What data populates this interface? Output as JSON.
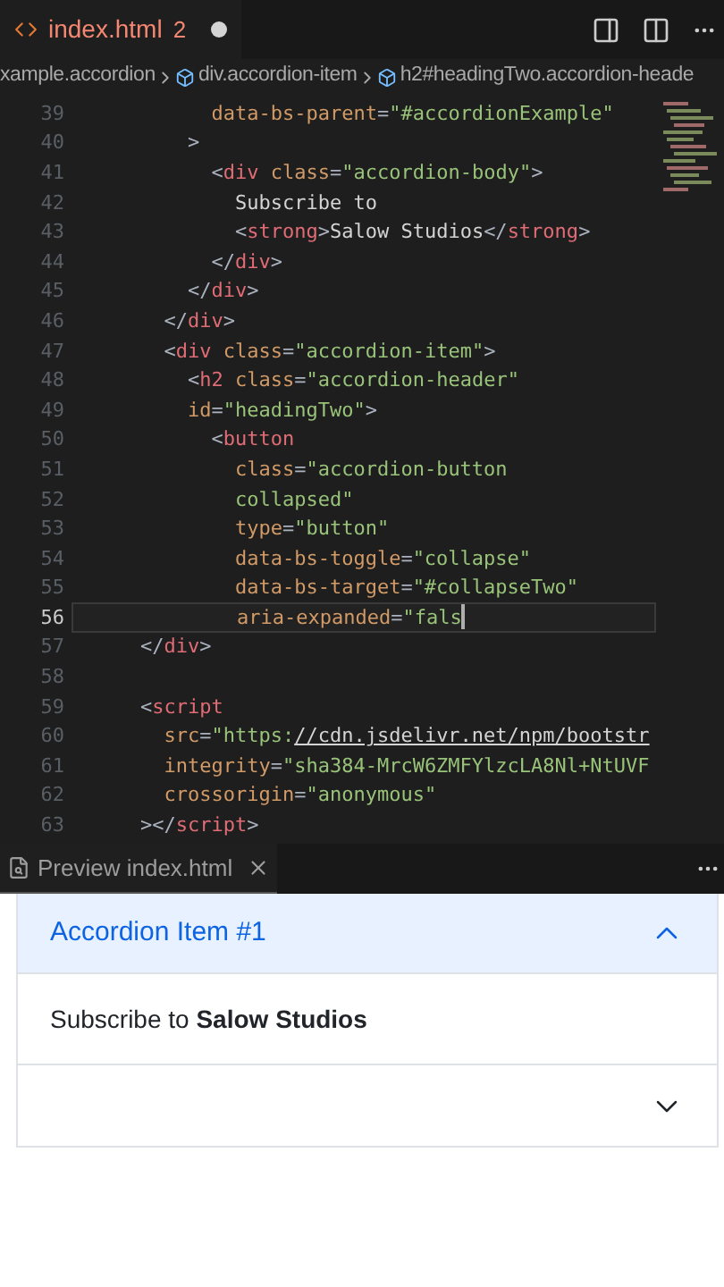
{
  "editor_tab": {
    "label": "index.html",
    "badge": "2",
    "modified": true,
    "selected": true
  },
  "breadcrumbs": [
    {
      "kind": "text",
      "label": "xample.accordion"
    },
    {
      "kind": "element",
      "label": "div.accordion-item"
    },
    {
      "kind": "element",
      "label": "h2#headingTwo.accordion-heade"
    }
  ],
  "editor": {
    "lines": [
      {
        "number": "39",
        "current": false,
        "tokens": [
          {
            "kind": "attr",
            "text": "          data-bs-parent"
          },
          {
            "kind": "punct",
            "text": "="
          },
          {
            "kind": "str",
            "text": "\"#accordionExample\""
          }
        ]
      },
      {
        "number": "40",
        "current": false,
        "tokens": [
          {
            "kind": "punct",
            "text": "        >"
          }
        ]
      },
      {
        "number": "41",
        "current": false,
        "tokens": [
          {
            "kind": "punct",
            "text": "          <"
          },
          {
            "kind": "tag",
            "text": "div"
          },
          {
            "kind": "attr",
            "text": " class"
          },
          {
            "kind": "punct",
            "text": "="
          },
          {
            "kind": "str",
            "text": "\"accordion-body\""
          },
          {
            "kind": "punct",
            "text": ">"
          }
        ]
      },
      {
        "number": "42",
        "current": false,
        "tokens": [
          {
            "kind": "text",
            "text": "            Subscribe to"
          }
        ]
      },
      {
        "number": "43",
        "current": false,
        "tokens": [
          {
            "kind": "punct",
            "text": "            <"
          },
          {
            "kind": "tag",
            "text": "strong"
          },
          {
            "kind": "punct",
            "text": ">"
          },
          {
            "kind": "text",
            "text": "Salow Studios"
          },
          {
            "kind": "punct",
            "text": "</"
          },
          {
            "kind": "tag",
            "text": "strong"
          },
          {
            "kind": "punct",
            "text": ">"
          }
        ]
      },
      {
        "number": "44",
        "current": false,
        "tokens": [
          {
            "kind": "punct",
            "text": "          </"
          },
          {
            "kind": "tag",
            "text": "div"
          },
          {
            "kind": "punct",
            "text": ">"
          }
        ]
      },
      {
        "number": "45",
        "current": false,
        "tokens": [
          {
            "kind": "punct",
            "text": "        </"
          },
          {
            "kind": "tag",
            "text": "div"
          },
          {
            "kind": "punct",
            "text": ">"
          }
        ]
      },
      {
        "number": "46",
        "current": false,
        "tokens": [
          {
            "kind": "punct",
            "text": "      </"
          },
          {
            "kind": "tag",
            "text": "div"
          },
          {
            "kind": "punct",
            "text": ">"
          }
        ]
      },
      {
        "number": "47",
        "current": false,
        "tokens": [
          {
            "kind": "punct",
            "text": "      <"
          },
          {
            "kind": "tag",
            "text": "div"
          },
          {
            "kind": "attr",
            "text": " class"
          },
          {
            "kind": "punct",
            "text": "="
          },
          {
            "kind": "str",
            "text": "\"accordion-item\""
          },
          {
            "kind": "punct",
            "text": ">"
          }
        ]
      },
      {
        "number": "48",
        "current": false,
        "tokens": [
          {
            "kind": "punct",
            "text": "        <"
          },
          {
            "kind": "tag",
            "text": "h2"
          },
          {
            "kind": "attr",
            "text": " class"
          },
          {
            "kind": "punct",
            "text": "="
          },
          {
            "kind": "str",
            "text": "\"accordion-header\""
          }
        ]
      },
      {
        "number": "49",
        "current": false,
        "tokens": [
          {
            "kind": "attr",
            "text": "        id"
          },
          {
            "kind": "punct",
            "text": "="
          },
          {
            "kind": "str",
            "text": "\"headingTwo\""
          },
          {
            "kind": "punct",
            "text": ">"
          }
        ]
      },
      {
        "number": "50",
        "current": false,
        "tokens": [
          {
            "kind": "punct",
            "text": "          <"
          },
          {
            "kind": "tag",
            "text": "button"
          }
        ]
      },
      {
        "number": "51",
        "current": false,
        "tokens": [
          {
            "kind": "attr",
            "text": "            class"
          },
          {
            "kind": "punct",
            "text": "="
          },
          {
            "kind": "str",
            "text": "\"accordion-button"
          }
        ]
      },
      {
        "number": "52",
        "current": false,
        "tokens": [
          {
            "kind": "str",
            "text": "            collapsed\""
          }
        ]
      },
      {
        "number": "53",
        "current": false,
        "tokens": [
          {
            "kind": "attr",
            "text": "            type"
          },
          {
            "kind": "punct",
            "text": "="
          },
          {
            "kind": "str",
            "text": "\"button\""
          }
        ]
      },
      {
        "number": "54",
        "current": false,
        "tokens": [
          {
            "kind": "attr",
            "text": "            data-bs-toggle"
          },
          {
            "kind": "punct",
            "text": "="
          },
          {
            "kind": "str",
            "text": "\"collapse\""
          }
        ]
      },
      {
        "number": "55",
        "current": false,
        "tokens": [
          {
            "kind": "attr",
            "text": "            data-bs-target"
          },
          {
            "kind": "punct",
            "text": "="
          },
          {
            "kind": "str",
            "text": "\"#collapseTwo\""
          }
        ]
      },
      {
        "number": "56",
        "current": true,
        "tokens": [
          {
            "kind": "attr",
            "text": "            aria-expanded"
          },
          {
            "kind": "punct",
            "text": "="
          },
          {
            "kind": "str",
            "text": "\"fals"
          }
        ]
      },
      {
        "number": "57",
        "current": false,
        "tokens": [
          {
            "kind": "punct",
            "text": "    </"
          },
          {
            "kind": "tag",
            "text": "div"
          },
          {
            "kind": "punct",
            "text": ">"
          }
        ]
      },
      {
        "number": "58",
        "current": false
      },
      {
        "number": "59",
        "current": false,
        "tokens": [
          {
            "kind": "punct",
            "text": "    <"
          },
          {
            "kind": "tag",
            "text": "script"
          }
        ]
      },
      {
        "number": "60",
        "current": false,
        "tokens": [
          {
            "kind": "attr",
            "text": "      src"
          },
          {
            "kind": "punct",
            "text": "="
          },
          {
            "kind": "str",
            "text": "\"https:"
          },
          {
            "kind": "link",
            "text": "//cdn.jsdelivr.net/npm/bootstr"
          }
        ]
      },
      {
        "number": "61",
        "current": false,
        "tokens": [
          {
            "kind": "attr",
            "text": "      integrity"
          },
          {
            "kind": "punct",
            "text": "="
          },
          {
            "kind": "str",
            "text": "\"sha384-MrcW6ZMFYlzcLA8Nl+NtUVF"
          }
        ]
      },
      {
        "number": "62",
        "current": false,
        "tokens": [
          {
            "kind": "attr",
            "text": "      crossorigin"
          },
          {
            "kind": "punct",
            "text": "="
          },
          {
            "kind": "str",
            "text": "\"anonymous\""
          }
        ]
      },
      {
        "number": "63",
        "current": false,
        "tokens": [
          {
            "kind": "punct",
            "text": "    ></"
          },
          {
            "kind": "tag",
            "text": "script"
          },
          {
            "kind": "punct",
            "text": ">"
          }
        ]
      }
    ]
  },
  "preview_tab": {
    "label": "Preview index.html"
  },
  "accordion": {
    "items": [
      {
        "title": "Accordion Item #1",
        "expanded": true,
        "body": "Subscribe to **Salow Studios**"
      },
      {
        "expanded": false
      }
    ]
  }
}
